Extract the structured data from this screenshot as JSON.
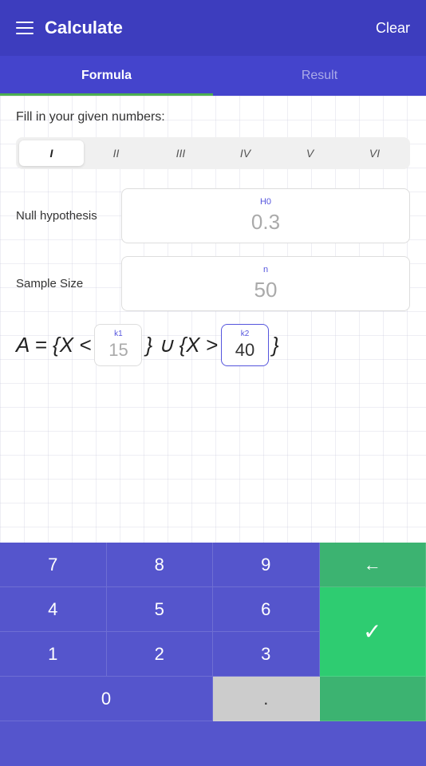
{
  "header": {
    "title": "Calculate",
    "clear_label": "Clear",
    "menu_icon": "hamburger"
  },
  "tabs": [
    {
      "id": "formula",
      "label": "Formula",
      "active": true
    },
    {
      "id": "result",
      "label": "Result",
      "active": false
    }
  ],
  "content": {
    "fill_label": "Fill in your given numbers:",
    "roman_tabs": [
      {
        "label": "I",
        "active": true
      },
      {
        "label": "II",
        "active": false
      },
      {
        "label": "III",
        "active": false
      },
      {
        "label": "IV",
        "active": false
      },
      {
        "label": "V",
        "active": false
      },
      {
        "label": "VI",
        "active": false
      }
    ],
    "fields": [
      {
        "id": "null-hypothesis",
        "label": "Null hypothesis",
        "box_label": "H0",
        "value": "0.3"
      },
      {
        "id": "sample-size",
        "label": "Sample Size",
        "box_label": "n",
        "value": "50"
      }
    ],
    "formula": {
      "prefix": "A = {X <",
      "k1_label": "k1",
      "k1_value": "15",
      "middle": "} ∪ {X >",
      "k2_label": "k2",
      "k2_value": "40",
      "suffix": "}"
    }
  },
  "numpad": {
    "buttons": [
      {
        "id": "7",
        "label": "7",
        "type": "digit"
      },
      {
        "id": "8",
        "label": "8",
        "type": "digit"
      },
      {
        "id": "9",
        "label": "9",
        "type": "digit"
      },
      {
        "id": "backspace",
        "label": "←",
        "type": "backspace"
      },
      {
        "id": "4",
        "label": "4",
        "type": "digit"
      },
      {
        "id": "5",
        "label": "5",
        "type": "digit"
      },
      {
        "id": "6",
        "label": "6",
        "type": "digit"
      },
      {
        "id": "check",
        "label": "✓",
        "type": "check"
      },
      {
        "id": "1",
        "label": "1",
        "type": "digit"
      },
      {
        "id": "2",
        "label": "2",
        "type": "digit"
      },
      {
        "id": "3",
        "label": "3",
        "type": "digit"
      },
      {
        "id": "0",
        "label": "0",
        "type": "zero"
      },
      {
        "id": "dot",
        "label": ".",
        "type": "dot"
      }
    ]
  }
}
